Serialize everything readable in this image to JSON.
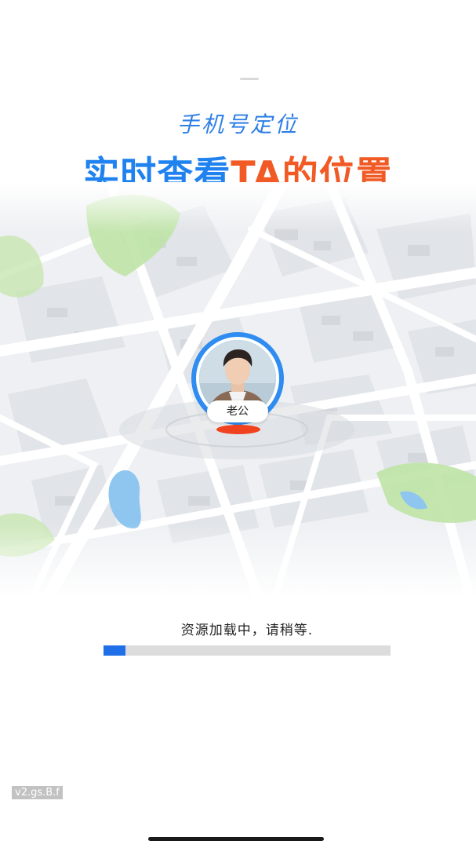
{
  "header": {
    "subtitle": "手机号定位",
    "headline_blue": "实时查看",
    "headline_orange": "TA的位置"
  },
  "map": {
    "marker": {
      "label": "老公",
      "avatar": "male-portrait"
    }
  },
  "loading": {
    "text": "资源加载中，请稍等.",
    "progress": 0.077
  },
  "watermark": "v2.gs.B.f",
  "colors": {
    "accent_blue": "#1f82ef",
    "accent_orange": "#f15a24",
    "progress_fill": "#1f6fe8",
    "progress_track": "#dcdcdc",
    "map_park": "#bfe3a6",
    "map_water": "#8ec6f0"
  }
}
